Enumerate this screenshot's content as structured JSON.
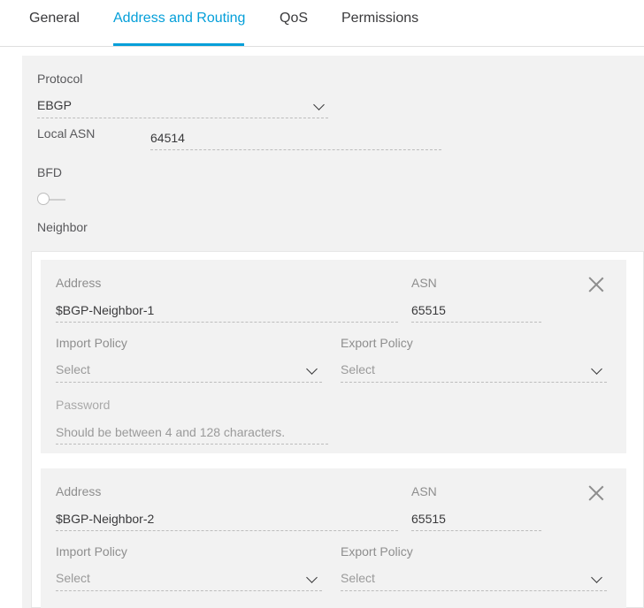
{
  "tabs": [
    {
      "label": "General"
    },
    {
      "label": "Address and Routing"
    },
    {
      "label": "QoS"
    },
    {
      "label": "Permissions"
    }
  ],
  "accent_color": "#049fd9",
  "form": {
    "protocol_label": "Protocol",
    "protocol_value": "EBGP",
    "local_asn_label": "Local ASN",
    "local_asn_value": "64514",
    "bfd_label": "BFD",
    "bfd_enabled": false,
    "neighbor_label": "Neighbor"
  },
  "neighbors": [
    {
      "address_label": "Address",
      "address_value": "$BGP-Neighbor-1",
      "asn_label": "ASN",
      "asn_value": "65515",
      "import_label": "Import Policy",
      "import_placeholder": "Select",
      "export_label": "Export Policy",
      "export_placeholder": "Select",
      "password_label": "Password",
      "password_hint": "Should be between 4 and 128 characters."
    },
    {
      "address_label": "Address",
      "address_value": "$BGP-Neighbor-2",
      "asn_label": "ASN",
      "asn_value": "65515",
      "import_label": "Import Policy",
      "import_placeholder": "Select",
      "export_label": "Export Policy",
      "export_placeholder": "Select"
    }
  ]
}
